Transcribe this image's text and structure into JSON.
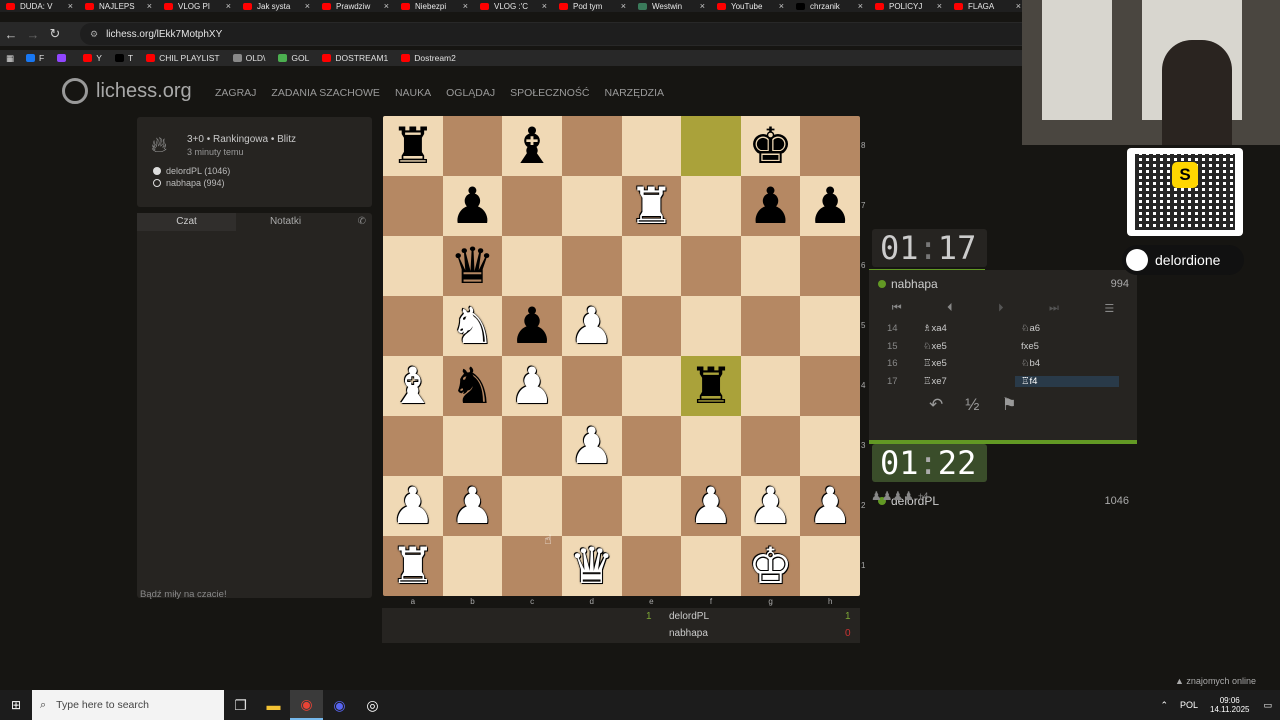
{
  "browser": {
    "tabs": [
      {
        "label": "DUDA: V",
        "color": "#ff0000"
      },
      {
        "label": "NAJLEPS",
        "color": "#ff0000"
      },
      {
        "label": "VLOG PI",
        "color": "#ff0000"
      },
      {
        "label": "Jak systa",
        "color": "#ff0000"
      },
      {
        "label": "Prawdziw",
        "color": "#ff0000"
      },
      {
        "label": "Niebezpi",
        "color": "#ff0000"
      },
      {
        "label": "VLOG :'C",
        "color": "#ff0000"
      },
      {
        "label": "Pod tym",
        "color": "#ff0000"
      },
      {
        "label": "Westwin",
        "color": "#3a7a5a"
      },
      {
        "label": "YouTube",
        "color": "#ff0000"
      },
      {
        "label": "chrzanik",
        "color": "#000000"
      },
      {
        "label": "POLICYJ",
        "color": "#ff0000"
      },
      {
        "label": "FLAGA",
        "color": "#ff0000"
      }
    ],
    "url": "lichess.org/lEkk7MotphXY",
    "bookmarks": [
      {
        "label": "F",
        "color": "#1877f2"
      },
      {
        "label": "",
        "color": "#9146ff"
      },
      {
        "label": "Y",
        "color": "#ff0000"
      },
      {
        "label": "T",
        "color": "#000000"
      },
      {
        "label": "CHIL PLAYLIST",
        "color": "#ff0000"
      },
      {
        "label": "OLD\\",
        "color": "#888888"
      },
      {
        "label": "GOL",
        "color": "#4caf50"
      },
      {
        "label": "DOSTREAM1",
        "color": "#ff0000"
      },
      {
        "label": "Dostream2",
        "color": "#ff0000"
      }
    ]
  },
  "site": {
    "logo": "lichess.org",
    "nav": [
      "ZAGRAJ",
      "ZADANIA SZACHOWE",
      "NAUKA",
      "OGLĄDAJ",
      "SPOŁECZNOŚĆ",
      "NARZĘDZIA"
    ]
  },
  "game_info": {
    "setup": "3+0 • Rankingowa • Blitz",
    "time_ago": "3 minuty temu",
    "white_player": "delordPL (1046)",
    "black_player": "nabhapa (994)"
  },
  "chat": {
    "tab_chat": "Czat",
    "tab_notes": "Notatki",
    "placeholder": "Bądź miły na czacie!"
  },
  "board": {
    "rows": [
      [
        "bR",
        "",
        "bB",
        "",
        "",
        "",
        "bK",
        ""
      ],
      [
        "",
        "bP",
        "",
        "",
        "wR",
        "",
        "bP",
        "bP"
      ],
      [
        "",
        "bQ",
        "",
        "",
        "",
        "",
        "",
        ""
      ],
      [
        "",
        "wN",
        "bP",
        "wP",
        "",
        "",
        "",
        ""
      ],
      [
        "wB",
        "bN",
        "wP",
        "",
        "",
        "bR",
        "",
        ""
      ],
      [
        "",
        "",
        "",
        "wP",
        "",
        "",
        "",
        ""
      ],
      [
        "wP",
        "wP",
        "",
        "",
        "",
        "wP",
        "wP",
        "wP"
      ],
      [
        "wR",
        "",
        "",
        "wQ",
        "",
        "",
        "wK",
        ""
      ]
    ],
    "highlight": [
      [
        0,
        5
      ],
      [
        4,
        5
      ]
    ],
    "ranks": [
      "8",
      "7",
      "6",
      "5",
      "4",
      "3",
      "2",
      "1"
    ],
    "files": [
      "a",
      "b",
      "c",
      "d",
      "e",
      "f",
      "g",
      "h"
    ]
  },
  "score": {
    "p1_name": "delordPL",
    "p1_score": "1",
    "p2_name": "nabhapa",
    "p2_score": "0",
    "left_score": "1"
  },
  "clocks": {
    "top": {
      "min": "01",
      "sec": "17"
    },
    "bottom": {
      "min": "01",
      "sec": "22"
    }
  },
  "players": {
    "top": {
      "name": "nabhapa",
      "rating": "994"
    },
    "bottom": {
      "name": "delordPL",
      "rating": "1046"
    }
  },
  "moves": [
    {
      "num": "14",
      "w": "♗xa4",
      "b": "♘a6"
    },
    {
      "num": "15",
      "w": "♘xe5",
      "b": "fxe5"
    },
    {
      "num": "16",
      "w": "♖xe5",
      "b": "♘b4"
    },
    {
      "num": "17",
      "w": "♖xe7",
      "b": "♖f4"
    }
  ],
  "material": {
    "icons": "♟♟♟♟",
    "diff": "+4"
  },
  "stream": {
    "handle": "delordione",
    "qr_letter": "S"
  },
  "friends": "znajomych online",
  "taskbar": {
    "search_placeholder": "Type here to search",
    "lang": "POL",
    "time": "09:06",
    "date": "14.11.2025"
  }
}
